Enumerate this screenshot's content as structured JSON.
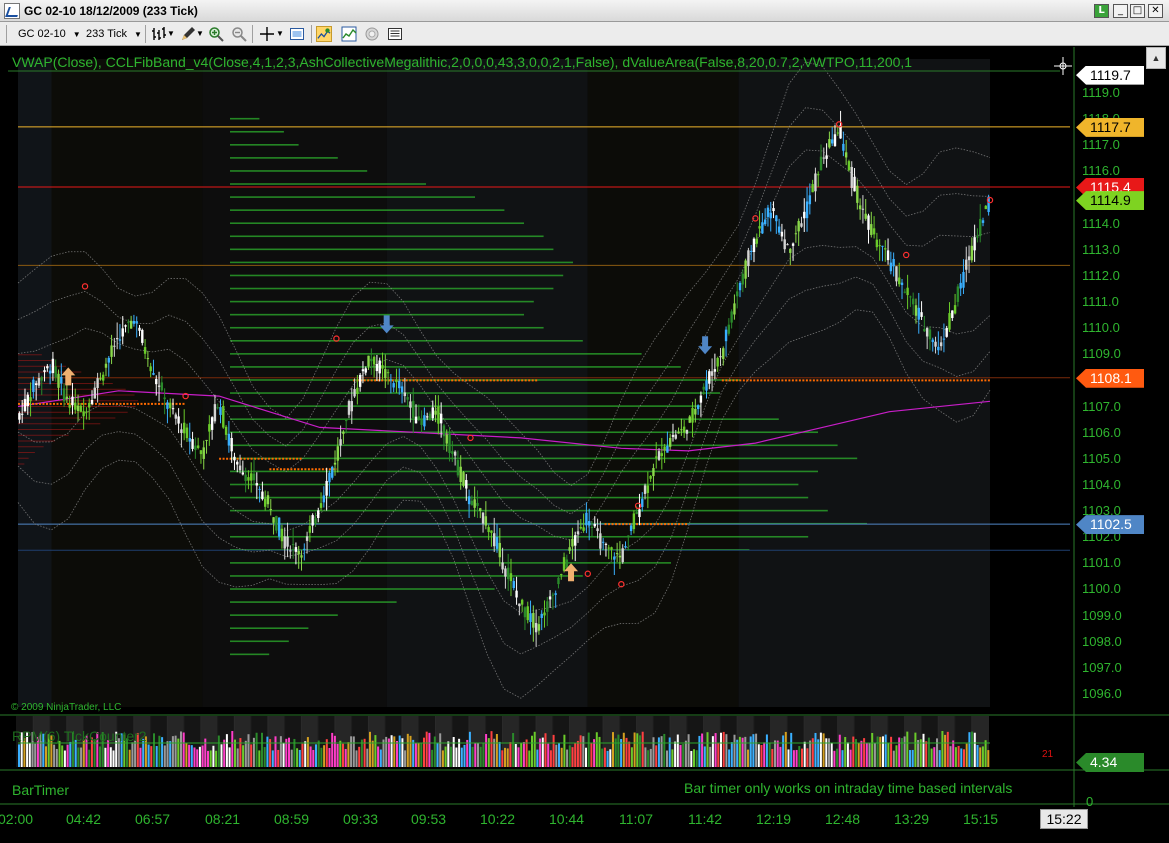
{
  "window": {
    "title": "GC 02-10  18/12/2009 (233 Tick)",
    "buttons": {
      "link": "L",
      "minimize": "_",
      "maximize": "□",
      "close": "✕"
    }
  },
  "toolbar": {
    "instrument": "GC 02-10",
    "period": "233 Tick",
    "icons": [
      "bar-type-icon",
      "draw-pencil-icon",
      "zoom-in-icon",
      "zoom-out-icon",
      "crosshair-icon",
      "properties-icon",
      "data-box-icon",
      "indicators-icon",
      "strategy-icon",
      "chart-trader-icon"
    ]
  },
  "indicators": {
    "text": "VWAP(Close),  CCLFibBand_v4(Close,4,1,2,3,AshCollectiveMegalithic,2,0,0,0,43,3,0,0,2,1,False),  dValueArea(False,8,20,0.7,2,VWTPO,11,200,1"
  },
  "copyright": "© 2009 NinjaTrader, LLC",
  "subpanels": {
    "rpm_label": "RPM(6)  TickCounter2",
    "rpm_count": "21",
    "rpm_value": "4.34",
    "rpm_zero": "0",
    "bartimer_label": "BarTimer",
    "bartimer_message": "Bar timer only works on intraday time based intervals"
  },
  "price_axis": {
    "labels": [
      "1119.0",
      "1118.0",
      "1117.0",
      "1116.0",
      "1115.0",
      "1114.0",
      "1113.0",
      "1112.0",
      "1111.0",
      "1110.0",
      "1109.0",
      "1108.0",
      "1107.0",
      "1106.0",
      "1105.0",
      "1104.0",
      "1103.0",
      "1102.0",
      "1101.0",
      "1100.0",
      "1099.0",
      "1098.0",
      "1097.0",
      "1096.0"
    ],
    "tags": [
      {
        "value": "1119.7",
        "bg": "#ffffff",
        "fg": "#000000"
      },
      {
        "value": "1117.7",
        "bg": "#f0b52b",
        "fg": "#000000"
      },
      {
        "value": "1115.4",
        "bg": "#e81818",
        "fg": "#ffffff"
      },
      {
        "value": "1114.9",
        "bg": "#7ed321",
        "fg": "#000000"
      },
      {
        "value": "1108.1",
        "bg": "#ff5a10",
        "fg": "#ffffff"
      },
      {
        "value": "1102.5",
        "bg": "#4f86c6",
        "fg": "#ffffff"
      }
    ]
  },
  "time_axis": {
    "labels": [
      "02:00",
      "04:42",
      "06:57",
      "08:21",
      "08:59",
      "09:33",
      "09:53",
      "10:22",
      "10:44",
      "11:07",
      "11:42",
      "12:19",
      "12:48",
      "13:29",
      "15:15"
    ],
    "current": "15:22"
  },
  "colors": {
    "background": "#000000",
    "text_green": "#2fb52f",
    "volume_profile": "#2aa62a",
    "vwap": "#c81ec8",
    "band": "#8c8c8c",
    "level_orange": "#e0a020",
    "level_red": "#e81818",
    "level_blue": "#4f86c6",
    "poc": "#ff6a00"
  },
  "chart_data": {
    "type": "candlestick",
    "title": "",
    "ylim": [
      1095.5,
      1120.3
    ],
    "x": [
      "02:00",
      "04:42",
      "06:57",
      "08:21",
      "08:59",
      "09:33",
      "09:53",
      "10:22",
      "10:44",
      "11:07",
      "11:42",
      "12:19",
      "12:48",
      "13:29",
      "15:15"
    ],
    "close_path": [
      [
        0,
        1106.5
      ],
      [
        1,
        1107.8
      ],
      [
        2,
        1108.6
      ],
      [
        3,
        1107.2
      ],
      [
        4,
        1106.8
      ],
      [
        5,
        1108.2
      ],
      [
        6,
        1109.6
      ],
      [
        7,
        1110.4
      ],
      [
        8,
        1108.4
      ],
      [
        9,
        1107.0
      ],
      [
        10,
        1106.0
      ],
      [
        11,
        1105.2
      ],
      [
        12,
        1107.2
      ],
      [
        13,
        1104.8
      ],
      [
        14,
        1104.2
      ],
      [
        15,
        1103.2
      ],
      [
        16,
        1101.8
      ],
      [
        17,
        1101.4
      ],
      [
        18,
        1103.2
      ],
      [
        19,
        1105.0
      ],
      [
        20,
        1107.4
      ],
      [
        21,
        1108.9
      ],
      [
        22,
        1108.2
      ],
      [
        23,
        1107.6
      ],
      [
        24,
        1106.4
      ],
      [
        25,
        1106.8
      ],
      [
        26,
        1105.2
      ],
      [
        27,
        1103.4
      ],
      [
        28,
        1102.6
      ],
      [
        29,
        1101.0
      ],
      [
        30,
        1099.4
      ],
      [
        31,
        1098.6
      ],
      [
        32,
        1099.8
      ],
      [
        33,
        1101.6
      ],
      [
        34,
        1102.8
      ],
      [
        35,
        1101.6
      ],
      [
        36,
        1101.2
      ],
      [
        37,
        1103.0
      ],
      [
        38,
        1104.8
      ],
      [
        39,
        1105.8
      ],
      [
        40,
        1106.2
      ],
      [
        41,
        1107.8
      ],
      [
        42,
        1109.0
      ],
      [
        43,
        1111.4
      ],
      [
        44,
        1113.4
      ],
      [
        45,
        1114.6
      ],
      [
        46,
        1113.0
      ],
      [
        47,
        1114.4
      ],
      [
        48,
        1116.4
      ],
      [
        49,
        1117.6
      ],
      [
        50,
        1115.2
      ],
      [
        51,
        1113.6
      ],
      [
        52,
        1112.6
      ],
      [
        53,
        1111.4
      ],
      [
        54,
        1110.2
      ],
      [
        55,
        1109.2
      ],
      [
        56,
        1111.0
      ],
      [
        57,
        1113.2
      ],
      [
        58,
        1114.9
      ]
    ],
    "vwap_path": [
      [
        0,
        1107.0
      ],
      [
        6,
        1107.6
      ],
      [
        12,
        1107.4
      ],
      [
        18,
        1106.2
      ],
      [
        24,
        1106.0
      ],
      [
        30,
        1105.8
      ],
      [
        36,
        1105.4
      ],
      [
        40,
        1105.3
      ],
      [
        44,
        1105.6
      ],
      [
        48,
        1106.2
      ],
      [
        52,
        1106.8
      ],
      [
        58,
        1107.2
      ]
    ],
    "band_offsets": [
      -4.2,
      -2.8,
      -1.5,
      1.5,
      2.8,
      4.2
    ],
    "levels": [
      {
        "value": 1117.7,
        "color": "#f0b52b"
      },
      {
        "value": 1115.4,
        "color": "#e81818"
      },
      {
        "value": 1102.5,
        "color": "#4f86c6"
      },
      {
        "value": 1112.4,
        "color": "#8a5a10"
      },
      {
        "value": 1108.1,
        "color": "#7a2a0a"
      },
      {
        "value": 1101.5,
        "color": "#1f3f6f"
      }
    ],
    "poc_segments": [
      {
        "from": 0,
        "to": 10,
        "value": 1107.1
      },
      {
        "from": 20,
        "to": 31,
        "value": 1108.0
      },
      {
        "from": 12,
        "to": 17,
        "value": 1105.0
      },
      {
        "from": 15,
        "to": 19,
        "value": 1104.6
      },
      {
        "from": 35,
        "to": 40,
        "value": 1102.5
      },
      {
        "from": 42,
        "to": 58,
        "value": 1108.0
      }
    ],
    "signals": [
      {
        "type": "arrow-down",
        "index": 22,
        "value": 1109.8,
        "color": "#4f86c6"
      },
      {
        "type": "arrow-down",
        "index": 41,
        "value": 1109.0,
        "color": "#4f86c6"
      },
      {
        "type": "arrow-up",
        "index": 3,
        "value": 1108.5,
        "color": "#f0b070"
      },
      {
        "type": "arrow-up",
        "index": 33,
        "value": 1101.0,
        "color": "#f0b070"
      }
    ],
    "volume_profile": [
      [
        1118.0,
        30
      ],
      [
        1117.5,
        55
      ],
      [
        1117.0,
        70
      ],
      [
        1116.5,
        110
      ],
      [
        1116.0,
        140
      ],
      [
        1115.5,
        200
      ],
      [
        1115.0,
        250
      ],
      [
        1114.5,
        280
      ],
      [
        1114.0,
        300
      ],
      [
        1113.5,
        320
      ],
      [
        1113.0,
        330
      ],
      [
        1112.5,
        350
      ],
      [
        1112.0,
        340
      ],
      [
        1111.5,
        330
      ],
      [
        1111.0,
        310
      ],
      [
        1110.5,
        300
      ],
      [
        1110.0,
        320
      ],
      [
        1109.5,
        360
      ],
      [
        1109.0,
        420
      ],
      [
        1108.5,
        460
      ],
      [
        1108.0,
        520
      ],
      [
        1107.5,
        500
      ],
      [
        1107.0,
        480
      ],
      [
        1106.5,
        560
      ],
      [
        1106.0,
        600
      ],
      [
        1105.5,
        620
      ],
      [
        1105.0,
        640
      ],
      [
        1104.5,
        600
      ],
      [
        1104.0,
        580
      ],
      [
        1103.5,
        590
      ],
      [
        1103.0,
        610
      ],
      [
        1102.5,
        650
      ],
      [
        1102.0,
        590
      ],
      [
        1101.5,
        530
      ],
      [
        1101.0,
        450
      ],
      [
        1100.5,
        360
      ],
      [
        1100.0,
        270
      ],
      [
        1099.5,
        170
      ],
      [
        1099.0,
        110
      ],
      [
        1098.5,
        80
      ],
      [
        1098.0,
        60
      ],
      [
        1097.5,
        40
      ]
    ],
    "sessions": [
      {
        "from": 0,
        "to": 2,
        "color": "#101418"
      },
      {
        "from": 2,
        "to": 11,
        "color": "#0c0c08"
      },
      {
        "from": 11,
        "to": 22,
        "color": "#0d0d0d"
      },
      {
        "from": 22,
        "to": 34,
        "color": "#101214"
      },
      {
        "from": 34,
        "to": 43,
        "color": "#0c0c08"
      },
      {
        "from": 43,
        "to": 58,
        "color": "#101214"
      }
    ],
    "rpm_colors": [
      "#ff3dc8",
      "#3ab0ff",
      "#d4a020",
      "#ffffff",
      "#6acb2a",
      "#9a9a9a",
      "#ff4040",
      "#2a8a2a"
    ]
  }
}
